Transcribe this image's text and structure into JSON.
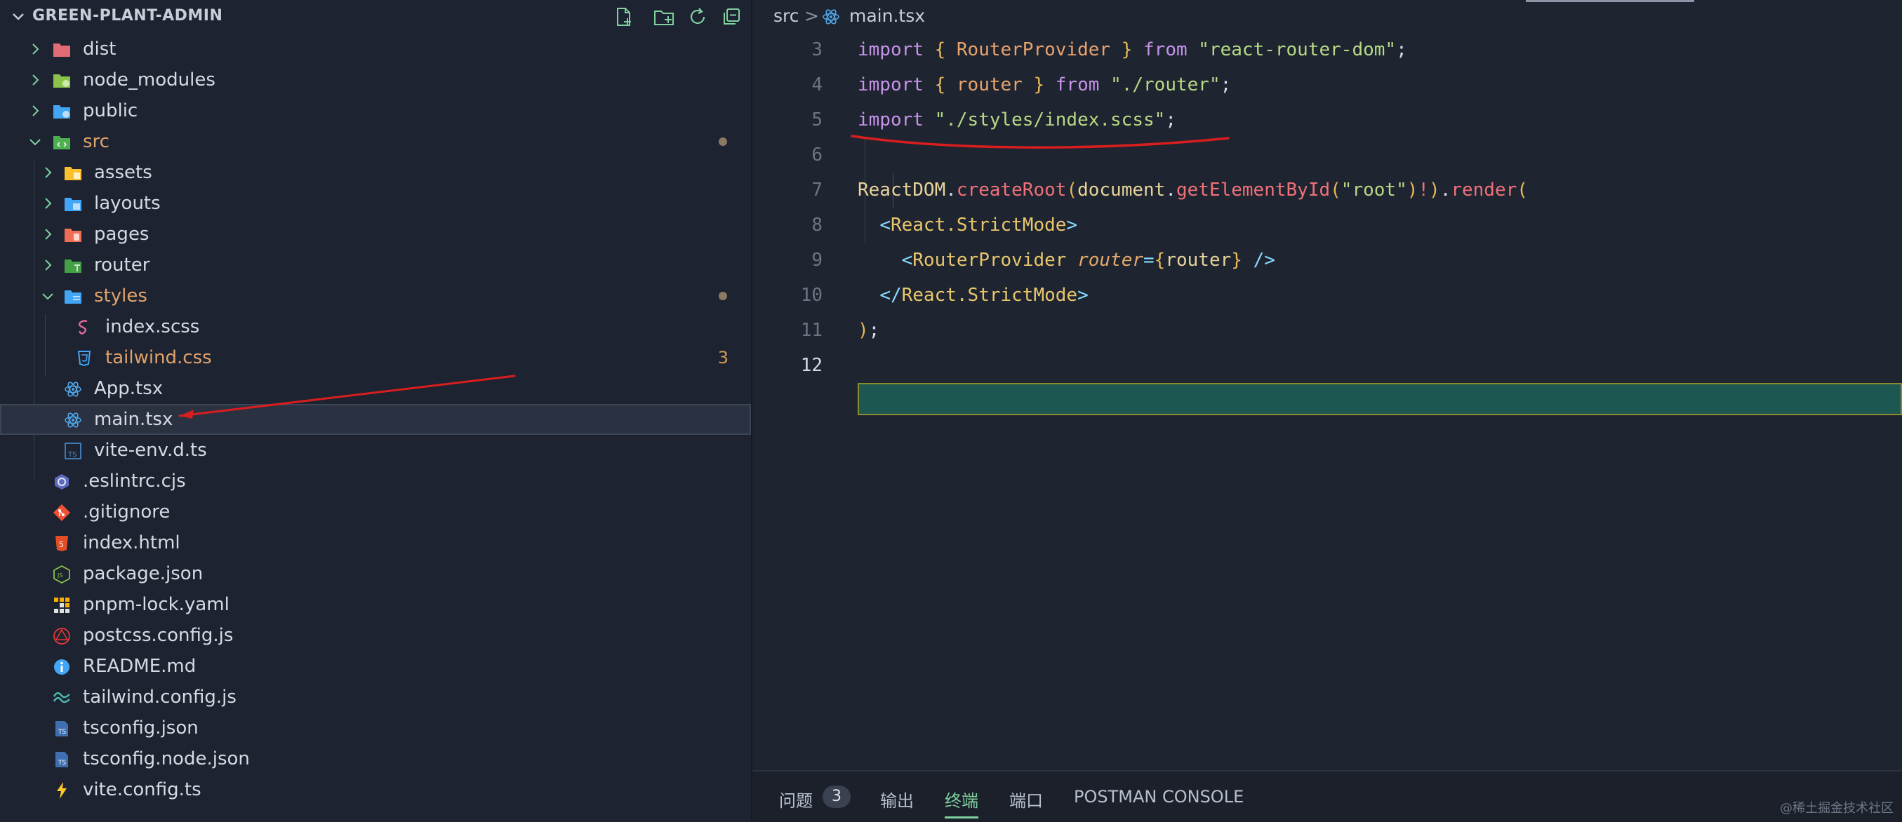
{
  "explorer": {
    "title": "GREEN-PLANT-ADMIN",
    "actions": [
      "new-file-icon",
      "new-folder-icon",
      "refresh-icon",
      "collapse-all-icon"
    ]
  },
  "tree": [
    {
      "label": "dist",
      "kind": "folder",
      "expanded": false,
      "icon_color": "#e06c75"
    },
    {
      "label": "node_modules",
      "kind": "folder",
      "expanded": false,
      "icon_color": "#8bc34a"
    },
    {
      "label": "public",
      "kind": "folder",
      "expanded": false,
      "icon_color": "#42a5f5"
    },
    {
      "label": "src",
      "kind": "folder",
      "expanded": true,
      "icon_color": "#4caf50",
      "modified": true
    },
    {
      "label": "assets",
      "kind": "folder",
      "expanded": false,
      "icon_color": "#fbc02d"
    },
    {
      "label": "layouts",
      "kind": "folder",
      "expanded": false,
      "icon_color": "#42a5f5"
    },
    {
      "label": "pages",
      "kind": "folder",
      "expanded": false,
      "icon_color": "#ef6c57"
    },
    {
      "label": "router",
      "kind": "folder",
      "expanded": false,
      "icon_color": "#43a047"
    },
    {
      "label": "styles",
      "kind": "folder",
      "expanded": true,
      "icon_color": "#42a5f5",
      "modified": true
    },
    {
      "label": "index.scss",
      "kind": "file",
      "icon": "sass-icon"
    },
    {
      "label": "tailwind.css",
      "kind": "file",
      "icon": "css-icon",
      "problems": "3"
    },
    {
      "label": "App.tsx",
      "kind": "file",
      "icon": "react-icon"
    },
    {
      "label": "main.tsx",
      "kind": "file",
      "icon": "react-icon",
      "selected": true
    },
    {
      "label": "vite-env.d.ts",
      "kind": "file",
      "icon": "typescript-def-icon"
    },
    {
      "label": ".eslintrc.cjs",
      "kind": "file",
      "icon": "eslint-icon"
    },
    {
      "label": ".gitignore",
      "kind": "file",
      "icon": "git-icon"
    },
    {
      "label": "index.html",
      "kind": "file",
      "icon": "html-icon"
    },
    {
      "label": "package.json",
      "kind": "file",
      "icon": "nodejs-icon"
    },
    {
      "label": "pnpm-lock.yaml",
      "kind": "file",
      "icon": "pnpm-icon"
    },
    {
      "label": "postcss.config.js",
      "kind": "file",
      "icon": "postcss-icon"
    },
    {
      "label": "README.md",
      "kind": "file",
      "icon": "info-icon"
    },
    {
      "label": "tailwind.config.js",
      "kind": "file",
      "icon": "tailwind-icon"
    },
    {
      "label": "tsconfig.json",
      "kind": "file",
      "icon": "tsconfig-icon"
    },
    {
      "label": "tsconfig.node.json",
      "kind": "file",
      "icon": "tsconfig-icon"
    },
    {
      "label": "vite.config.ts",
      "kind": "file",
      "icon": "vite-icon"
    }
  ],
  "breadcrumb": {
    "folder": "src",
    "separator": ">",
    "file": "main.tsx"
  },
  "code_lines": [
    {
      "n": "3",
      "tokens": [
        [
          "kw",
          "import"
        ],
        [
          "pl",
          " "
        ],
        [
          "br",
          "{"
        ],
        [
          "pl",
          " "
        ],
        [
          "id",
          "RouterProvider"
        ],
        [
          "pl",
          " "
        ],
        [
          "br",
          "}"
        ],
        [
          "pl",
          " "
        ],
        [
          "kw",
          "from"
        ],
        [
          "pl",
          " "
        ],
        [
          "str",
          "\"react-router-dom\""
        ],
        [
          "pl",
          ";"
        ]
      ]
    },
    {
      "n": "4",
      "tokens": [
        [
          "kw",
          "import"
        ],
        [
          "pl",
          " "
        ],
        [
          "br",
          "{"
        ],
        [
          "pl",
          " "
        ],
        [
          "id",
          "router"
        ],
        [
          "pl",
          " "
        ],
        [
          "br",
          "}"
        ],
        [
          "pl",
          " "
        ],
        [
          "kw",
          "from"
        ],
        [
          "pl",
          " "
        ],
        [
          "str",
          "\"./router\""
        ],
        [
          "pl",
          ";"
        ]
      ]
    },
    {
      "n": "5",
      "tokens": [
        [
          "kw",
          "import"
        ],
        [
          "pl",
          " "
        ],
        [
          "str",
          "\"./styles/index.scss\""
        ],
        [
          "pl",
          ";"
        ]
      ]
    },
    {
      "n": "6",
      "tokens": []
    },
    {
      "n": "7",
      "tokens": [
        [
          "obj",
          "ReactDOM"
        ],
        [
          "pl",
          "."
        ],
        [
          "fn",
          "createRoot"
        ],
        [
          "br",
          "("
        ],
        [
          "obj",
          "document"
        ],
        [
          "pl",
          "."
        ],
        [
          "fn",
          "getElementById"
        ],
        [
          "br",
          "("
        ],
        [
          "str",
          "\"root\""
        ],
        [
          "br",
          ")"
        ],
        [
          "fn",
          "!"
        ],
        [
          "br",
          ")"
        ],
        [
          "pl",
          "."
        ],
        [
          "fn",
          "render"
        ],
        [
          "br",
          "("
        ]
      ]
    },
    {
      "n": "8",
      "tokens": [
        [
          "pl",
          "  "
        ],
        [
          "tag",
          "<"
        ],
        [
          "comp",
          "React.StrictMode"
        ],
        [
          "tag",
          ">"
        ]
      ]
    },
    {
      "n": "9",
      "tokens": [
        [
          "pl",
          "    "
        ],
        [
          "tag",
          "<"
        ],
        [
          "comp",
          "RouterProvider"
        ],
        [
          "pl",
          " "
        ],
        [
          "attr",
          "router"
        ],
        [
          "tag",
          "="
        ],
        [
          "br",
          "{"
        ],
        [
          "obj",
          "router"
        ],
        [
          "br",
          "}"
        ],
        [
          "pl",
          " "
        ],
        [
          "tag",
          "/>"
        ]
      ]
    },
    {
      "n": "10",
      "tokens": [
        [
          "pl",
          "  "
        ],
        [
          "tag",
          "</"
        ],
        [
          "comp",
          "React.StrictMode"
        ],
        [
          "tag",
          ">"
        ]
      ]
    },
    {
      "n": "11",
      "tokens": [
        [
          "br",
          ")"
        ],
        [
          "pl",
          ";"
        ]
      ]
    },
    {
      "n": "12",
      "tokens": []
    }
  ],
  "panel": {
    "tabs": [
      {
        "label": "问题",
        "badge": "3"
      },
      {
        "label": "输出"
      },
      {
        "label": "终端",
        "active": true
      },
      {
        "label": "端口"
      },
      {
        "label": "POSTMAN CONSOLE"
      }
    ]
  },
  "watermark": "@稀土掘金技术社区",
  "colors": {
    "annotation_red": "#d81e1e",
    "current_line_bg": "#1d5752",
    "active_tab": "#7fd1a0"
  }
}
